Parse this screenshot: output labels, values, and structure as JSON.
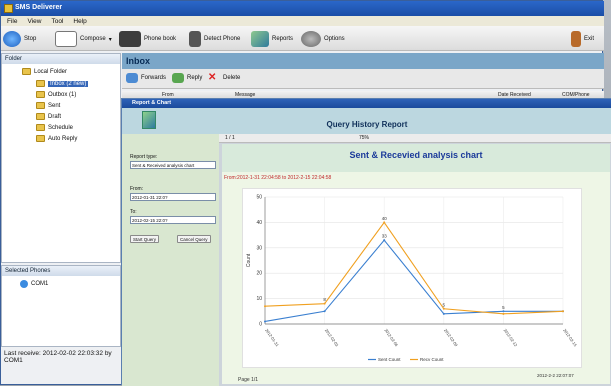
{
  "window": {
    "title": "SMS Deliverer"
  },
  "menu": [
    "File",
    "View",
    "Tool",
    "Help"
  ],
  "toolbar": {
    "stop": "Stop",
    "compose": "Compose",
    "phonebook": "Phone book",
    "detect": "Detect Phone",
    "reports": "Reports",
    "options": "Options",
    "exit": "Exit"
  },
  "folder": {
    "header": "Folder",
    "root": "Local Folder",
    "items": [
      "Inbox (2 new)",
      "Outbox (1)",
      "Sent",
      "Draft",
      "Schedule",
      "Auto Reply"
    ]
  },
  "phones": {
    "header": "Selected Phones",
    "items": [
      "COM1"
    ]
  },
  "status": {
    "last_receive": "Last receive: 2012-02-02 22:03:32 by COM1"
  },
  "inbox": {
    "title": "Inbox",
    "actions": {
      "forwards": "Forwards",
      "reply": "Reply",
      "delete": "Delete"
    },
    "columns": {
      "from": "From",
      "message": "Message",
      "date": "Date Received",
      "phone": "COM/Phone"
    }
  },
  "query": {
    "window_title": "Report & Chart",
    "header": "Query History Report",
    "report_type_label": "Report type:",
    "report_type_value": "Sent & Received analysis chart",
    "from_label": "From:",
    "from_value": "2012-01-31 22:0?",
    "to_label": "To:",
    "to_value": "2012-02-15 22:0?",
    "start_button": "Start Query",
    "cancel_button": "Cancel Query"
  },
  "report": {
    "page_nav": "1 / 1",
    "zoom": "75%",
    "chart_title": "Sent & Recevied analysis chart",
    "from_to": "From:2012-1-31 22:04:58 to 2012-2-15 22:04:58",
    "generated": "2012-2-2 22:07:07",
    "page_info": "Page 1/1"
  },
  "chart_data": {
    "type": "line",
    "categories": [
      "2012-01-31",
      "2012-02-03",
      "2012-02-06",
      "2012-02-09",
      "2012-02-12",
      "2012-02-15"
    ],
    "series": [
      {
        "name": "Sent Count",
        "color": "#3a7fd0",
        "values": [
          1,
          5,
          33,
          4,
          5,
          5
        ]
      },
      {
        "name": "Recv Count",
        "color": "#f0a020",
        "values": [
          7,
          8,
          40,
          6,
          4,
          5
        ]
      }
    ],
    "data_labels": {
      "Sent Count": [
        "",
        "",
        "33",
        "",
        "5",
        ""
      ],
      "Recv Count": [
        "",
        "8",
        "40",
        "5",
        "",
        ""
      ]
    },
    "ylabel": "Count",
    "ylim": [
      0,
      50
    ],
    "yticks": [
      0,
      10,
      20,
      30,
      40,
      50
    ],
    "grid": true,
    "legend_position": "bottom"
  },
  "colors": {
    "accent": "#2b67c9",
    "inbox_header": "#7aa6c8"
  }
}
